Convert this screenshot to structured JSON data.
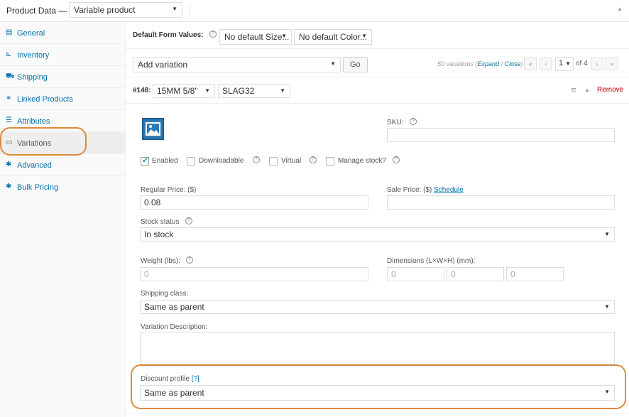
{
  "header": {
    "title": "Product Data —",
    "product_type": "Variable product"
  },
  "sidebar": {
    "items": [
      {
        "label": "General",
        "icon": "general-icon"
      },
      {
        "label": "Inventory",
        "icon": "inventory-icon"
      },
      {
        "label": "Shipping",
        "icon": "shipping-icon"
      },
      {
        "label": "Linked Products",
        "icon": "link-icon"
      },
      {
        "label": "Attributes",
        "icon": "attributes-icon"
      },
      {
        "label": "Variations",
        "icon": "variations-icon",
        "active": true
      },
      {
        "label": "Advanced",
        "icon": "gear-icon"
      },
      {
        "label": "Bulk Pricing",
        "icon": "gear-icon"
      }
    ]
  },
  "defaults": {
    "label": "Default Form Values:",
    "size": "No default Size...",
    "color": "No default Color..."
  },
  "variations_toolbar": {
    "action": "Add variation",
    "go": "Go",
    "count_text": "50 variations",
    "expand": "Expand",
    "separator": " / ",
    "close": "Close",
    "page": "1",
    "of": "of 4"
  },
  "variation": {
    "id": "#148:",
    "size": "15MM 5/8\"",
    "color": "SLAG32",
    "remove": "Remove",
    "sku_label": "SKU:",
    "sku_value": "",
    "enabled_label": "Enabled",
    "downloadable_label": "Downloadable",
    "virtual_label": "Virtual",
    "manage_stock_label": "Manage stock?",
    "enabled": true,
    "regular_price_label": "Regular Price: ($)",
    "regular_price": "0.08",
    "sale_price_label": "Sale Price: ($)",
    "schedule": "Schedule",
    "sale_price": "",
    "stock_status_label": "Stock status",
    "stock_status": "In stock",
    "weight_label": "Weight (lbs):",
    "weight_placeholder": "0",
    "dimensions_label": "Dimensions (L×W×H) (mm):",
    "dim_l": "0",
    "dim_w": "0",
    "dim_h": "0",
    "shipping_class_label": "Shipping class:",
    "shipping_class": "Same as parent",
    "description_label": "Variation Description:",
    "discount_label": "Discount profile",
    "discount_help": "[?]",
    "discount_profile": "Same as parent"
  },
  "colors": {
    "link": "#0073aa",
    "highlight": "#e08a3c"
  }
}
